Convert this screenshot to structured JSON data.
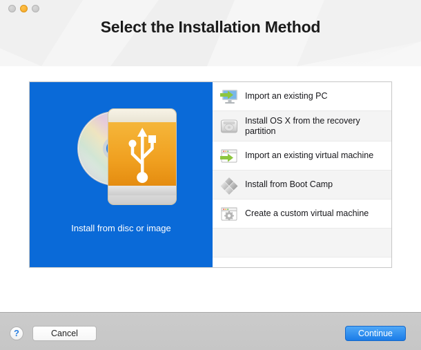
{
  "window": {
    "title": "Select the Installation Method",
    "traffic_lights": [
      {
        "name": "close",
        "color": "#c4c4c4"
      },
      {
        "name": "minimize",
        "color": "#f5a623"
      },
      {
        "name": "zoom",
        "color": "#c4c4c4"
      }
    ]
  },
  "hero": {
    "label": "Install from disc or image",
    "icon": "disc-and-usb-drive-icon",
    "background_color": "#0a6ad8",
    "text_color": "#ffffff"
  },
  "list": {
    "items": [
      {
        "label": "Import an existing PC",
        "icon": "monitor-import-icon"
      },
      {
        "label": "Install OS X from the recovery partition",
        "icon": "hard-disk-icon"
      },
      {
        "label": "Import an existing virtual machine",
        "icon": "window-import-icon"
      },
      {
        "label": "Install from Boot Camp",
        "icon": "boot-camp-diamonds-icon"
      },
      {
        "label": "Create a custom virtual machine",
        "icon": "window-gear-icon"
      }
    ]
  },
  "footer": {
    "help_label": "?",
    "cancel_label": "Cancel",
    "continue_label": "Continue",
    "continue_color": "#1a7ce8"
  }
}
